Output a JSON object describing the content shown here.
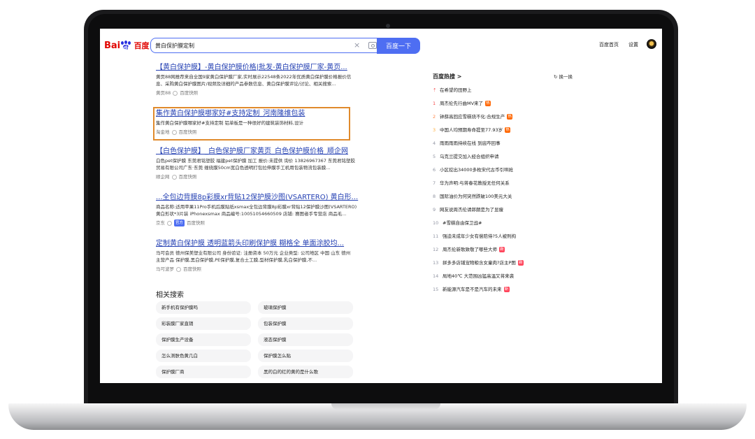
{
  "search": {
    "query": "黄白保护膜定制",
    "button": "百度一下"
  },
  "logo": {
    "bai": "Bai",
    "du": "du",
    "bd": "百度"
  },
  "top_links": [
    "百度首页",
    "设置"
  ],
  "results": [
    {
      "title": "【黄白保护膜】-黄白保护膜价格|批发-黄白保护膜厂家-黄页...",
      "desc1": "黄页88网推荐来自全国9家黄白保护膜厂家,实时展示22548条2022年优质黄白保护膜价格报价信",
      "desc2": "息、采购黄白保护膜图片/视频及详细的产品参数信息、黄白保护膜评论/讨论、相关搜索...",
      "source": "黄页88",
      "cache": "百度快照"
    },
    {
      "title": "集作黄白保护膜哪家好#支持定制_河南隆维包装",
      "desc1": "集作黄白保护膜哪家好#支持定制 铝单板是一种很好的建筑装饰材料,设计",
      "desc2": "",
      "source": "淘金地",
      "cache": "百度快照"
    },
    {
      "title": "【白色保护膜】_白色保护膜厂家黄页_白色保护膜价格_顺企网",
      "desc1": "白色pet保护膜 东莞君铭塑胶 福建pet保护膜 加工 报价:未提供 询价 13826967367 东莞君铭塑胶",
      "desc2": "贸易有限公司广东·东莞 缠绕膜50cm宽白色透明打包拉伸膜手工机用包装物流包装膜...",
      "source": "顺企网",
      "cache": "百度快照"
    },
    {
      "title": "...全包边背膜8p彩膜xr背贴12保护膜沙图(VSARTERO) 黄白形...",
      "desc1": "商品名称:适用苹果11Pro手机后膜贴纸xsmax全包边背膜8p彩膜xr背贴12保护膜沙图(VSARTERO)",
      "desc2": "黄白形状*3片装 iPhonexsmax 商品编号:10051054660509 店铺: 赛图者手专营店 商品毛...",
      "source": "京东",
      "tag": "官方",
      "cache": "百度快照"
    },
    {
      "title": "定制黄白保护膜 透明蓝箭头印刷保护膜 糊格全 单面涂胶均...",
      "desc1": "马可会员 德州保美塑业有限公司 身份验证: 注册资本 50万元 企业类型: 公司地区 中国 山东 德州",
      "desc2": "主营产品 保护膜,黑白保护膜,PE保护膜,复合土工膜,型材保护膜,乳白保护膜,不...",
      "source": "马可波罗",
      "cache": "百度快照"
    }
  ],
  "related": {
    "title": "相关搜索",
    "items": [
      "新手机有保护膜吗",
      "玻璃保护膜",
      "彩装膜厂家直销",
      "包装保护膜",
      "保护膜生产设备",
      "液态保护膜",
      "怎么测肤色黄几白",
      "保护膜怎么贴",
      "保护膜厂商",
      "黑的白的红的黄的是什么歌"
    ]
  },
  "hot": {
    "title": "百度热搜 >",
    "refresh": "换一换",
    "pinned": "在希望的田野上",
    "items": [
      {
        "num": "1",
        "text": "周杰伦先行曲MV来了",
        "badge": "热"
      },
      {
        "num": "2",
        "text": "钟薛高回应雪糕烧不化:合规生产",
        "badge": "热"
      },
      {
        "num": "3",
        "text": "中国人均预期寿命提至77.93岁",
        "badge": "热"
      },
      {
        "num": "4",
        "text": "雨雨雨雨持续在线 到底咋回事",
        "badge": ""
      },
      {
        "num": "5",
        "text": "乌克兰提交加入经合组织申请",
        "badge": ""
      },
      {
        "num": "6",
        "text": "小区挖出34000多枚宋代古币引哄抢",
        "badge": ""
      },
      {
        "num": "7",
        "text": "华为声明:与蒋春花教授无任何关系",
        "badge": ""
      },
      {
        "num": "8",
        "text": "国际油价为何突然跌破100美元大关",
        "badge": ""
      },
      {
        "num": "9",
        "text": "网友说周杰伦请郎朗是为了显瘦",
        "badge": ""
      },
      {
        "num": "10",
        "text": "#雪糕自由保卫战#",
        "badge": ""
      },
      {
        "num": "11",
        "text": "强迫未成年少女有偿陪侍?5人被刑拘",
        "badge": ""
      },
      {
        "num": "12",
        "text": "周杰伦新歌致敬了哪些大师",
        "badge": "新"
      },
      {
        "num": "13",
        "text": "拼多多店铺宠物粮含女童肉?店主P图",
        "badge": "新"
      },
      {
        "num": "14",
        "text": "局地40℃ 大范围凶猛高温又将来袭",
        "badge": ""
      },
      {
        "num": "15",
        "text": "新能源汽车是不是汽车的未来",
        "badge": "新"
      }
    ]
  }
}
